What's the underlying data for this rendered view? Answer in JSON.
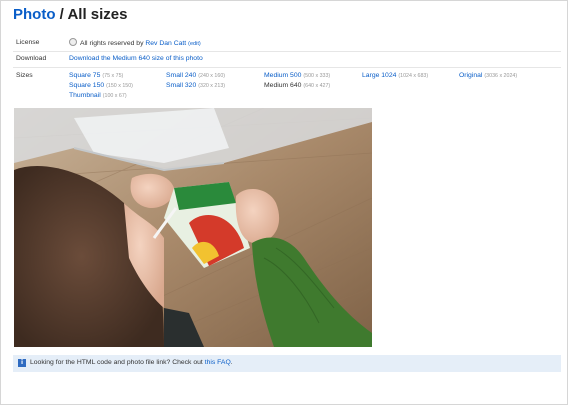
{
  "title": {
    "crumb": "Photo",
    "separator": " / ",
    "current": "All sizes"
  },
  "license": {
    "label": "License",
    "text": "All rights reserved by ",
    "author": "Rev Dan Catt",
    "edit": "(edit)",
    "icon": "copyright-icon"
  },
  "download": {
    "label": "Download",
    "link": "Download the Medium 640 size of this photo"
  },
  "sizes": {
    "label": "Sizes",
    "sq75": {
      "name": "Square 75",
      "dim": "(75 x 75)"
    },
    "sq150": {
      "name": "Square 150",
      "dim": "(150 x 150)"
    },
    "thumb": {
      "name": "Thumbnail",
      "dim": "(100 x 67)"
    },
    "s240": {
      "name": "Small 240",
      "dim": "(240 x 160)"
    },
    "s320": {
      "name": "Small 320",
      "dim": "(320 x 213)"
    },
    "m500": {
      "name": "Medium 500",
      "dim": "(500 x 333)"
    },
    "m640": {
      "name": "Medium 640",
      "dim": "(640 x 427)",
      "current": true
    },
    "l1024": {
      "name": "Large 1024",
      "dim": "(1024 x 683)"
    },
    "orig": {
      "name": "Original",
      "dim": "(3036 x 2024)"
    }
  },
  "photo": {
    "subject": "child drinking from a juice box",
    "icon": "photo-image"
  },
  "faq": {
    "icon": "info-icon",
    "text": "Looking for the HTML code and photo file link? Check out ",
    "link": "this FAQ",
    "end": "."
  },
  "colors": {
    "link": "#0a5ec8",
    "faq_bg": "#e5eef8",
    "text": "#333333"
  }
}
